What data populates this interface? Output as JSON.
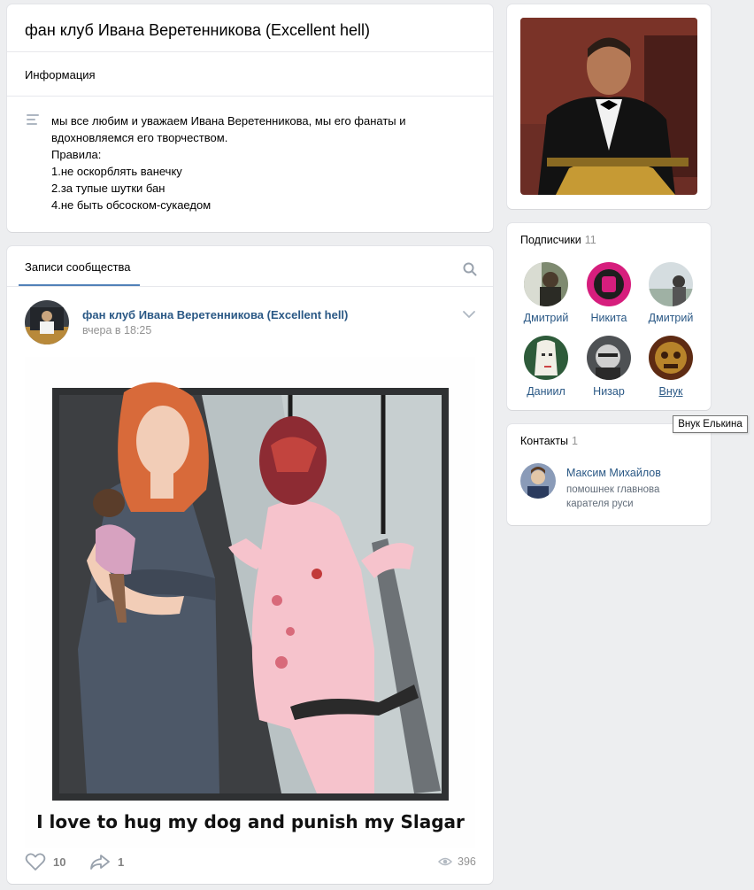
{
  "group": {
    "title": "фан клуб Ивана Веретенникова (Excellent hell)",
    "info_label": "Информация",
    "description": [
      "мы все любим и уважаем Ивана Веретенникова, мы его фанаты и",
      "вдохновляемся его творчеством.",
      "Правила:",
      "1.не оскорблять ванечку",
      "2.за тупые шутки бан",
      "4.не быть обсоском-сукаедом"
    ]
  },
  "wall": {
    "tab_label": "Записи сообщества",
    "post": {
      "author": "фан клуб Ивана Веретенникова (Excellent hell)",
      "time": "вчера в 18:25",
      "image_caption": "I love to hug my dog and punish my Slagar",
      "likes": "10",
      "shares": "1",
      "views": "396"
    }
  },
  "subscribers": {
    "title": "Подписчики",
    "count": "11",
    "items": [
      {
        "name": "Дмитрий"
      },
      {
        "name": "Никита"
      },
      {
        "name": "Дмитрий"
      },
      {
        "name": "Даниил"
      },
      {
        "name": "Низар"
      },
      {
        "name": "Внук"
      }
    ],
    "tooltip": "Внук Елькина"
  },
  "contacts": {
    "title": "Контакты",
    "count": "1",
    "name": "Максим Михайлов",
    "role": "помошнек главнова карателя руси"
  },
  "icons": {
    "menu": "description-icon",
    "search": "search-icon",
    "chevron": "chevron-down-icon",
    "like": "heart-icon",
    "share": "share-icon",
    "views": "eye-icon"
  },
  "colors": {
    "link": "#2a5885",
    "accent": "#5181b8",
    "background": "#edeef0"
  }
}
